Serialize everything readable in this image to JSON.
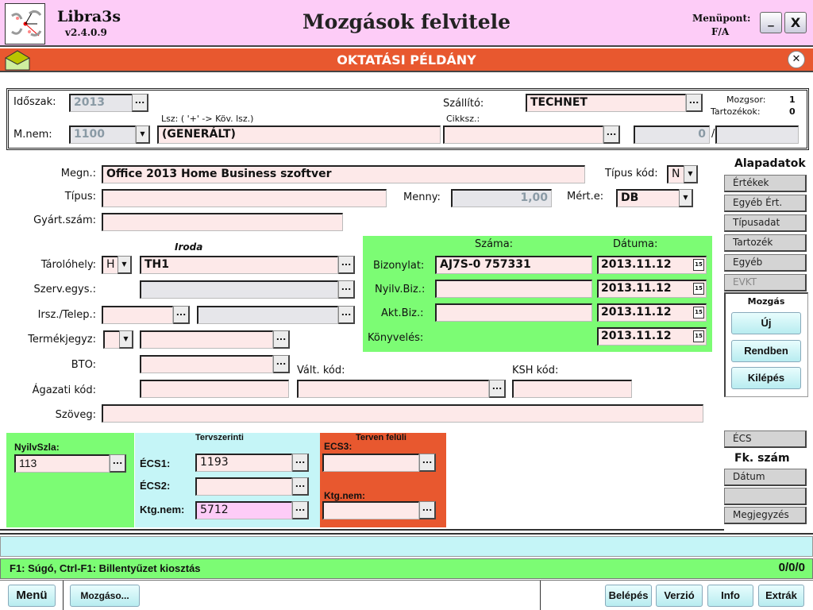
{
  "header": {
    "app_name": "Libra3s",
    "version": "v2.4.0.9",
    "title": "Mozgások felvitele",
    "menupont_label": "Menüpont:",
    "menupont_value": "F/A",
    "minimize": "_",
    "close": "X"
  },
  "banner": {
    "text": "OKTATÁSI PÉLDÁNY",
    "icon": "envelope-icon",
    "color": "#e8582f"
  },
  "top": {
    "idoszak_label": "Időszak:",
    "idoszak_value": "2013",
    "mnem_label": "M.nem:",
    "mnem_value": "1100",
    "lsz_label": "Lsz: ( '+' -> Köv. lsz.)",
    "lsz_value": "(GENERÁLT)",
    "szallito_label": "Szállító:",
    "szallito_value": "TECHNET",
    "cikksz_label": "Cikksz.:",
    "cikksz_value": "",
    "mozgsor_label": "Mozgsor:",
    "mozgsor_value": "1",
    "tartozekok_label": "Tartozékok:",
    "tartozekok_value": "0",
    "count_value": "0",
    "slash": "/",
    "count2_value": ""
  },
  "main": {
    "megn_label": "Megn.:",
    "megn_value": "Office 2013 Home Business szoftver",
    "tipuskod_label": "Típus kód:",
    "tipuskod_value": "N",
    "tipus_label": "Típus:",
    "tipus_value": "",
    "menny_label": "Menny:",
    "menny_value": "1,00",
    "merte_label": "Mért.e:",
    "merte_value": "DB",
    "gyartszam_label": "Gyárt.szám:",
    "gyartszam_value": "",
    "iroda_label": "Iroda",
    "tarolohely_label": "Tárolóhely:",
    "tarolohely_select": "H",
    "tarolohely_value": "TH1",
    "szerv_label": "Szerv.egys.:",
    "irsz_label": "Irsz./Telep.:",
    "termekjegyz_label": "Termékjegyz:",
    "bto_label": "BTO:",
    "valtkod_label": "Vált. kód:",
    "kshkod_label": "KSH kód:",
    "agazati_label": "Ágazati kód:",
    "szoveg_label": "Szöveg:",
    "szoveg_value": ""
  },
  "docs": {
    "szama_label": "Száma:",
    "datuma_label": "Dátuma:",
    "rows": [
      {
        "label": "Bizonylat:",
        "number": "AJ7S-0 757331",
        "date": "2013.11.12"
      },
      {
        "label": "Nyilv.Biz.:",
        "number": "",
        "date": "2013.11.12"
      },
      {
        "label": "Akt.Biz.:",
        "number": "",
        "date": "2013.11.12"
      },
      {
        "label": "Könyvelés:",
        "date": "2013.11.12"
      }
    ]
  },
  "side": {
    "alapadatok": "Alapadatok",
    "tabs": [
      "Értékek",
      "Egyéb Ért.",
      "Típusadat",
      "Tartozék",
      "Egyéb",
      "EVKT"
    ],
    "mozgas_label": "Mozgás",
    "buttons": [
      "Új",
      "Rendben",
      "Kilépés"
    ],
    "ecs_tab": "ÉCS",
    "fkszam": "Fk. szám",
    "tabs2": [
      "Dátum",
      "",
      "Megjegyzés"
    ]
  },
  "accounts": {
    "nyilvszla_label": "NyilvSzla:",
    "nyilvszla_value": "113",
    "tervszerinti": "Tervszerinti",
    "ecs1_label": "ÉCS1:",
    "ecs1_value": "1193",
    "ecs2_label": "ÉCS2:",
    "ecs2_value": "",
    "ktgnem_label": "Ktg.nem:",
    "ktgnem_value": "5712",
    "terven_feluli": "Terven felüli",
    "ecs3_label": "ECS3:",
    "ecs3_value": "",
    "ktgnem2_label": "Ktg.nem:",
    "ktgnem2_value": ""
  },
  "status": {
    "help": "F1: Súgó, Ctrl-F1: Billentyűzet kiosztás",
    "counter": "0/0/0"
  },
  "toolbar": {
    "menu": "Menü",
    "mozgaso": "Mozgáso...",
    "belepes": "Belépés",
    "verzio": "Verzió",
    "info": "Info",
    "extrak": "Extrák"
  },
  "colors": {
    "header": "#fdccf7",
    "green": "#7cfc74",
    "cyan": "#c5f5f7",
    "orange": "#e8582f"
  }
}
